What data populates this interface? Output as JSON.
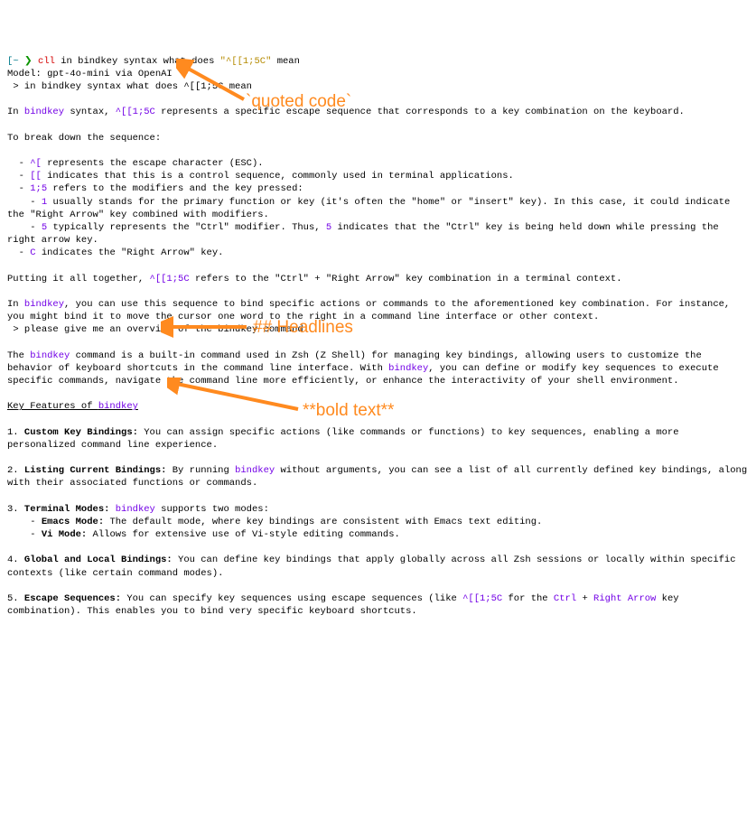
{
  "prompt": {
    "leftBracket": "[",
    "tilde": "~",
    "arrow": " ❯ ",
    "cmd": "cll",
    "rest": " in bindkey syntax what does ",
    "quoted": "\"^[[1;5C\"",
    "tail": " mean"
  },
  "line_model": "Model: gpt-4o-mini via OpenAI",
  "line_echo": " > in bindkey syntax what does ^[[1;5C mean",
  "intro_a": "In ",
  "intro_bk": "bindkey",
  "intro_b": " syntax, ",
  "intro_code": "^[[1;5C",
  "intro_c": " represents a specific escape sequence that corresponds to a key combination on the keyboard.",
  "break_heading": "To break down the sequence:",
  "bd": {
    "b1_a": "  - ",
    "b1_code": "^[",
    "b1_b": " represents the escape character (ESC).",
    "b2_a": "  - ",
    "b2_code": "[[",
    "b2_b": " indicates that this is a control sequence, commonly used in terminal applications.",
    "b3_a": "  - ",
    "b3_code": "1;5",
    "b3_b": " refers to the modifiers and the key pressed:",
    "b4_a": "    - ",
    "b4_code": "1",
    "b4_b": " usually stands for the primary function or key (it's often the \"home\" or \"insert\" key). In this case, it could indicate the \"Right Arrow\" key combined with modifiers.",
    "b5_a": "    - ",
    "b5_code": "5",
    "b5_b": " typically represents the \"Ctrl\" modifier. Thus, ",
    "b5_code2": "5",
    "b5_c": " indicates that the \"Ctrl\" key is being held down while pressing the right arrow key.",
    "b6_a": "  - ",
    "b6_code": "C",
    "b6_b": " indicates the \"Right Arrow\" key."
  },
  "together_a": "Putting it all together, ",
  "together_code": "^[[1;5C",
  "together_b": " refers to the \"Ctrl\" + \"Right Arrow\" key combination in a terminal context.",
  "usage_a": "In ",
  "usage_bk": "bindkey",
  "usage_b": ", you can use this sequence to bind specific actions or commands to the aforementioned key combination. For instance, you might bind it to move the cursor one word to the right in a command line interface or other context.",
  "prompt2": " > please give me an overview of the bindkey command",
  "ov_a": "The ",
  "ov_bk1": "bindkey",
  "ov_b": " command is a built-in command used in Zsh (Z Shell) for managing key bindings, allowing users to customize the behavior of keyboard shortcuts in the command line interface. With ",
  "ov_bk2": "bindkey",
  "ov_c": ", you can define or modify key sequences to execute specific commands, navigate the command line more efficiently, or enhance the interactivity of your shell environment.",
  "heading_a": "Key Features of ",
  "heading_bk": "bindkey",
  "feat1_a": "1. ",
  "feat1_h": "Custom Key Bindings:",
  "feat1_b": " You can assign specific actions (like commands or functions) to key sequences, enabling a more personalized command line experience.",
  "feat2_a": "2. ",
  "feat2_h": "Listing Current Bindings:",
  "feat2_b": " By running ",
  "feat2_bk": "bindkey",
  "feat2_c": " without arguments, you can see a list of all currently defined key bindings, along with their associated functions or commands.",
  "feat3_a": "3. ",
  "feat3_h": "Terminal Modes:",
  "feat3_b": " ",
  "feat3_bk": "bindkey",
  "feat3_c": " supports two modes:",
  "feat3_em_a": "    - ",
  "feat3_em_h": "Emacs Mode:",
  "feat3_em_b": " The default mode, where key bindings are consistent with Emacs text editing.",
  "feat3_vi_a": "    - ",
  "feat3_vi_h": "Vi Mode:",
  "feat3_vi_b": " Allows for extensive use of Vi-style editing commands.",
  "feat4_a": "4. ",
  "feat4_h": "Global and Local Bindings:",
  "feat4_b": " You can define key bindings that apply globally across all Zsh sessions or locally within specific contexts (like certain command modes).",
  "feat5_a": "5. ",
  "feat5_h": "Escape Sequences:",
  "feat5_b": " You can specify key sequences using escape sequences (like ",
  "feat5_code": "^[[1;5C",
  "feat5_c": " for the ",
  "feat5_ctrl": "Ctrl",
  "feat5_plus": " + ",
  "feat5_ra": "Right Arrow",
  "feat5_d": " key combination). This enables you to bind very specific keyboard shortcuts.",
  "annotations": {
    "quoted": "`quoted code`",
    "headlines": "## Headlines",
    "bold": "**bold text**"
  }
}
